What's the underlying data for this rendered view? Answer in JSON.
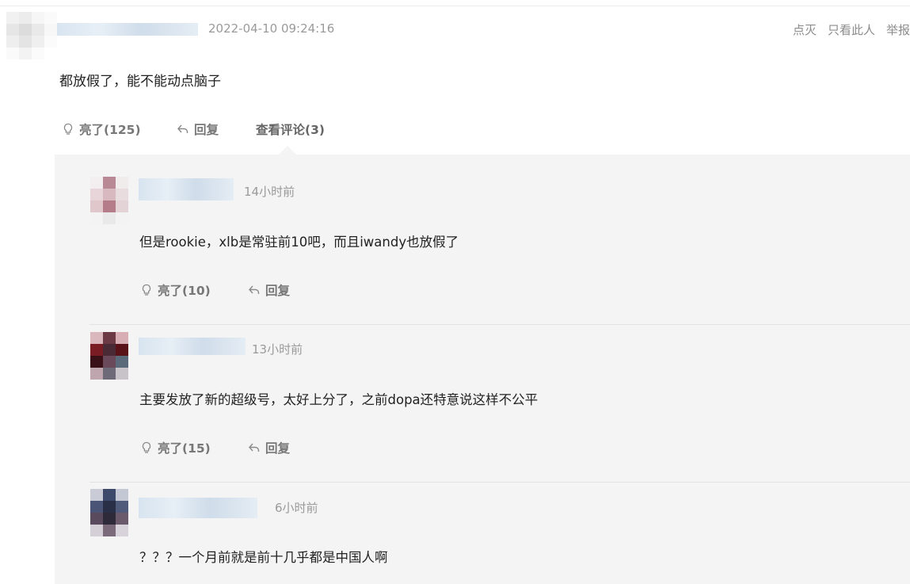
{
  "post": {
    "timestamp": "2022-04-10 09:24:16",
    "actions": [
      "点灭",
      "只看此人",
      "举报"
    ],
    "content": "都放假了，能不能动点脑子",
    "like_label": "亮了(125)",
    "reply_label": "回复",
    "view_comments_label": "查看评论(3)"
  },
  "replies": [
    {
      "time": "14小时前",
      "content": "但是rookie，xlb是常驻前10吧，而且iwandy也放假了",
      "like_label": "亮了(10)",
      "reply_label": "回复"
    },
    {
      "time": "13小时前",
      "content": "主要发放了新的超级号，太好上分了，之前dopa还特意说这样不公平",
      "like_label": "亮了(15)",
      "reply_label": "回复"
    },
    {
      "time": "6小时前",
      "content": "？？？一个月前就是前十几乎都是中国人啊"
    }
  ],
  "icons": {
    "like": "lightbulb-icon",
    "reply": "reply-arrow-icon"
  },
  "colors": {
    "text": "#222222",
    "muted": "#9a9a9a",
    "reply_bg": "#f4f4f4"
  }
}
